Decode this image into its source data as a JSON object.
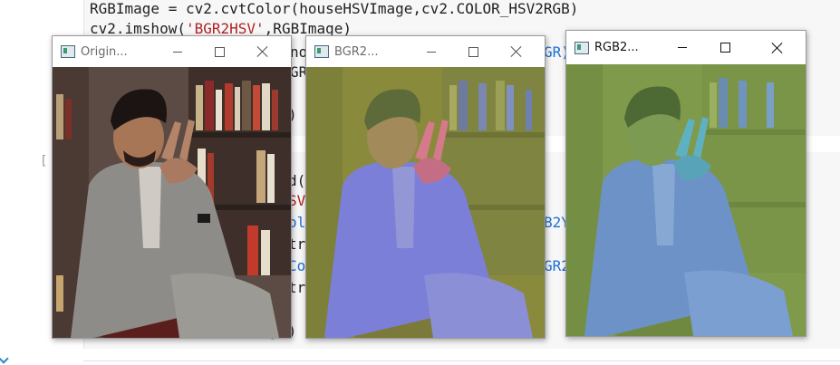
{
  "notebook": {
    "code_line_1": "RGBImage = cv2.cvtColor(houseHSVImage,cv2.COLOR_HSV2RGB)",
    "code_line_2_prefix": "cv2.imshow(",
    "code_line_2_string": "'BGR2HSV'",
    "code_line_2_suffix": ",RGBImage)",
    "fragment_a": "no",
    "fragment_b": "GR)",
    "fragment_c": "GR",
    "fragment_d": ")",
    "fragment_e": "d(",
    "fragment_f": "SV",
    "fragment_g": "olo",
    "fragment_h": "B2Y",
    "fragment_i": "tro",
    "fragment_j": "Col",
    "fragment_k": "GR2",
    "fragment_l": "tro",
    "fragment_m": "y",
    "fragment_n": "()",
    "prompt": "["
  },
  "windows": {
    "original": {
      "title": "Origin..."
    },
    "bgr2hsv": {
      "title": "BGR2..."
    },
    "rgb2": {
      "title": "RGB2..."
    }
  },
  "colors": {
    "original_bg": "#6b5a52",
    "hsv_tint": "#8a8f3c",
    "rgb_tint": "#7fa25a"
  }
}
